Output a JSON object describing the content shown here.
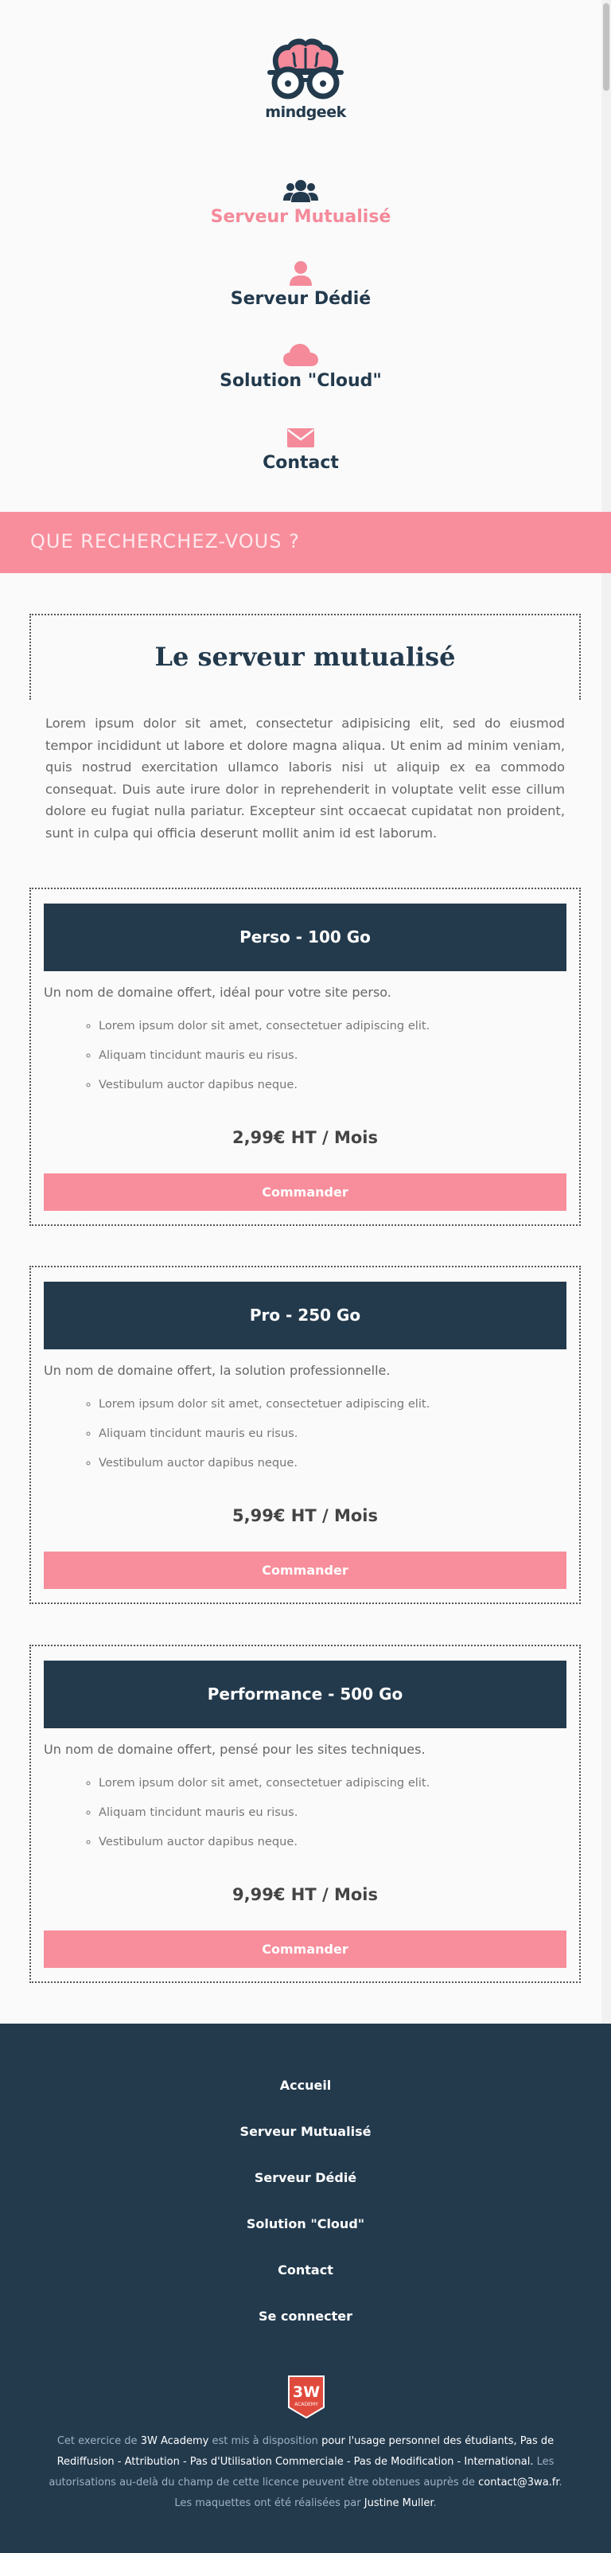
{
  "brand": {
    "name": "mindgeek"
  },
  "nav": [
    {
      "label": "Serveur Mutualisé",
      "icon": "users-icon",
      "active": true
    },
    {
      "label": "Serveur Dédié",
      "icon": "user-icon",
      "active": false
    },
    {
      "label": "Solution \"Cloud\"",
      "icon": "cloud-icon",
      "active": false
    },
    {
      "label": "Contact",
      "icon": "envelope-icon",
      "active": false
    }
  ],
  "search": {
    "text": "QUE RECHERCHEZ-VOUS ?"
  },
  "main": {
    "title": "Le serveur mutualisé",
    "intro": "Lorem ipsum dolor sit amet, consectetur adipisicing elit, sed do eiusmod tempor incididunt ut labore et dolore magna aliqua. Ut enim ad minim veniam, quis nostrud exercitation ullamco laboris nisi ut aliquip ex ea commodo consequat. Duis aute irure dolor in reprehenderit in voluptate velit esse cillum dolore eu fugiat nulla pariatur. Excepteur sint occaecat cupidatat non proident, sunt in culpa qui officia deserunt mollit anim id est laborum."
  },
  "offers": [
    {
      "title": "Perso - 100 Go",
      "description": "Un nom de domaine offert, idéal pour votre site perso.",
      "features": [
        "Lorem ipsum dolor sit amet, consectetuer adipiscing elit.",
        "Aliquam tincidunt mauris eu risus.",
        "Vestibulum auctor dapibus neque."
      ],
      "price": "2,99€ HT / Mois",
      "button": "Commander"
    },
    {
      "title": "Pro - 250 Go",
      "description": "Un nom de domaine offert, la solution professionnelle.",
      "features": [
        "Lorem ipsum dolor sit amet, consectetuer adipiscing elit.",
        "Aliquam tincidunt mauris eu risus.",
        "Vestibulum auctor dapibus neque."
      ],
      "price": "5,99€ HT / Mois",
      "button": "Commander"
    },
    {
      "title": "Performance - 500 Go",
      "description": "Un nom de domaine offert, pensé pour les sites techniques.",
      "features": [
        "Lorem ipsum dolor sit amet, consectetuer adipiscing elit.",
        "Aliquam tincidunt mauris eu risus.",
        "Vestibulum auctor dapibus neque."
      ],
      "price": "9,99€ HT / Mois",
      "button": "Commander"
    }
  ],
  "footer": {
    "links": [
      "Accueil",
      "Serveur Mutualisé",
      "Serveur Dédié",
      "Solution \"Cloud\"",
      "Contact",
      "Se connecter"
    ],
    "badge_top": "3W",
    "badge_bottom": "ACADEMY",
    "legal": {
      "p1": "Cet exercice de",
      "academy": "3W Academy",
      "p2": "est mis à disposition",
      "p3": "pour l'usage personnel des étudiants, Pas de Rediffusion - Attribution - Pas d'Utilisation Commerciale - Pas de Modification - International.",
      "p4": "Les autorisations au-delà du champ de cette licence peuvent être obtenues auprès de",
      "email": "contact@3wa.fr",
      "p5": ". Les maquettes ont été réalisées par",
      "author": "Justine Muller",
      "p6": "."
    }
  },
  "colors": {
    "navy": "#233a4d",
    "pink": "#f88e9c",
    "background": "#fafafa"
  }
}
